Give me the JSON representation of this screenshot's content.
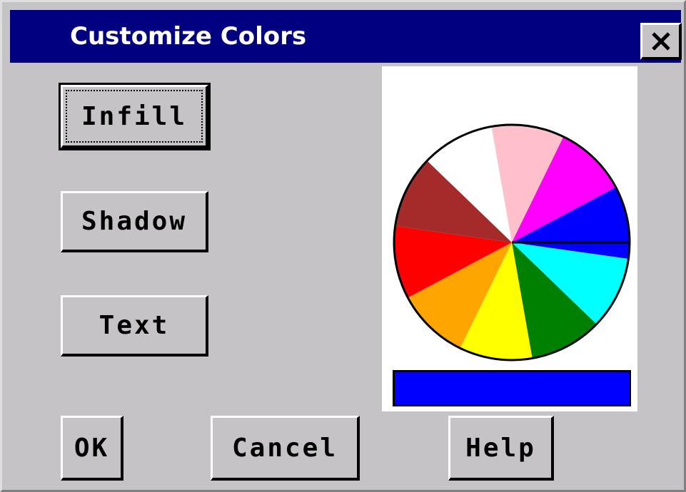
{
  "window": {
    "title": "Customize Colors",
    "close_label": "X"
  },
  "buttons": {
    "infill": "Infill",
    "shadow": "Shadow",
    "text": "Text",
    "ok": "OK",
    "cancel": "Cancel",
    "help": "Help"
  },
  "color_wheel": {
    "segments": [
      {
        "name": "pink",
        "color": "#ffc0cb"
      },
      {
        "name": "magenta",
        "color": "#ff00ff"
      },
      {
        "name": "blue",
        "color": "#0000ff"
      },
      {
        "name": "cyan",
        "color": "#00ffff"
      },
      {
        "name": "green",
        "color": "#008000"
      },
      {
        "name": "yellow",
        "color": "#ffff00"
      },
      {
        "name": "orange",
        "color": "#ffa500"
      },
      {
        "name": "red",
        "color": "#ff0000"
      },
      {
        "name": "brown",
        "color": "#a52a2a"
      },
      {
        "name": "white",
        "color": "#ffffff"
      }
    ],
    "selected_color": "#0000ff"
  },
  "colors": {
    "title_bar": "#000080",
    "dialog_face": "#c6c3c6"
  }
}
